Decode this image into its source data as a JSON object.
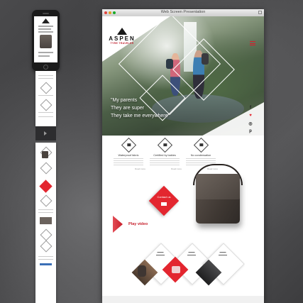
{
  "window": {
    "title": "Web Screen Presentation"
  },
  "brand": {
    "name": "ASPEN",
    "subtitle": "TYRE TRAVELER"
  },
  "hero": {
    "lines": [
      "\"My parents",
      "They are super",
      "They take me everywhere\""
    ]
  },
  "social": [
    "f",
    "♥",
    "◎",
    "p"
  ],
  "features": [
    {
      "title": "Waterproof fabric",
      "more": "Read more"
    },
    {
      "title": "Certified by babies",
      "more": "Read more"
    },
    {
      "title": "No condensation",
      "more": "Read more"
    }
  ],
  "contact": {
    "label": "Contact us"
  },
  "video": {
    "label": "Play video"
  },
  "phone": {
    "heading": "ASPEN"
  },
  "colors": {
    "accent": "#e3262f",
    "dark": "#1a1a1a"
  }
}
